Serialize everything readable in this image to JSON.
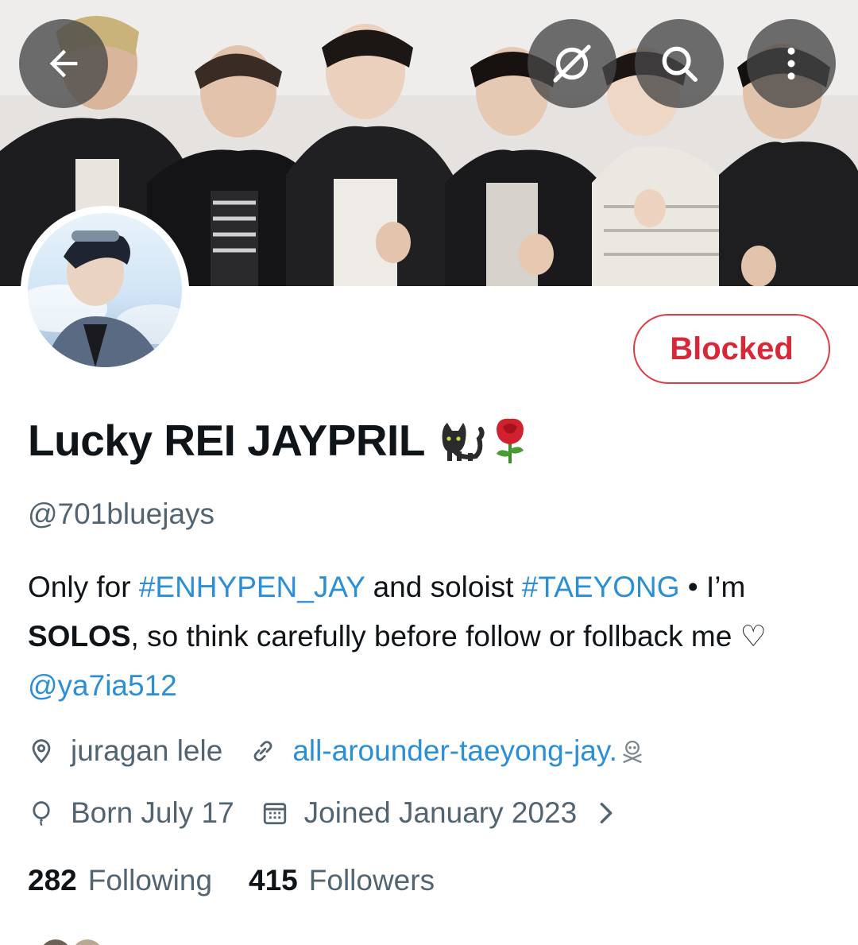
{
  "header": {
    "back_icon": "arrow-left-icon",
    "grok_icon": "grok-slash-icon",
    "search_icon": "search-icon",
    "more_icon": "more-vertical-icon"
  },
  "profile": {
    "display_name": "Lucky REI JAYPRIL",
    "handle": "@701bluejays",
    "relationship_button": "Blocked",
    "bio": {
      "part1": "Only for ",
      "tag1": "#ENHYPEN_JAY",
      "part2": " and soloist ",
      "tag2": "#TAEYONG",
      "part3": " • I’m ",
      "bold": "SOLOS",
      "part4": ", so think carefully before follow or follback me ♡ ",
      "mention": "@ya7ia512"
    },
    "location": "juragan lele",
    "website": "all-arounder-taeyong-jay.",
    "birthday": "Born July 17",
    "joined": "Joined January 2023",
    "following_count": "282",
    "following_label": "Following",
    "followers_count": "415",
    "followers_label": "Followers"
  },
  "colors": {
    "blocked_red": "#d9273a",
    "link_blue": "#2a8fd6",
    "secondary_text": "#536471"
  }
}
